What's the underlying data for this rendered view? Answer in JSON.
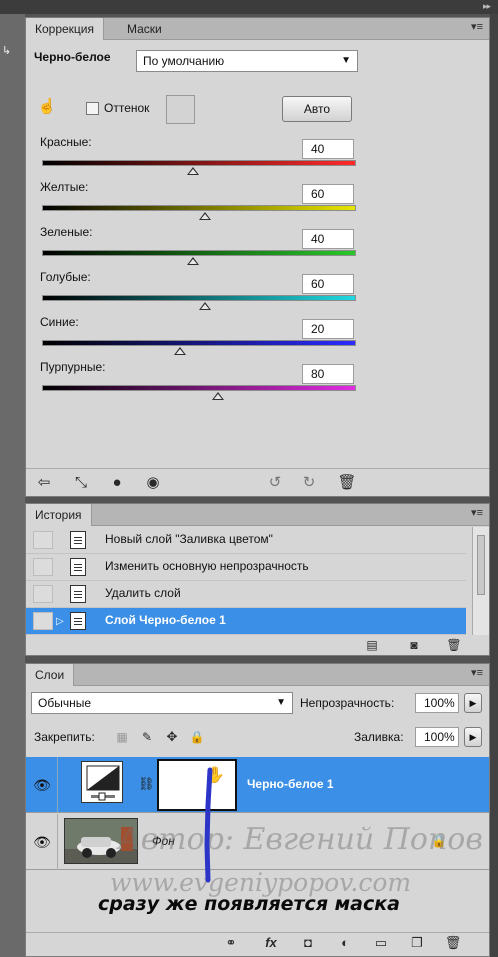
{
  "adjustments": {
    "tabs": [
      {
        "label": "Коррекция"
      },
      {
        "label": "Маски"
      }
    ],
    "title": "Черно-белое",
    "preset": "По умолчанию",
    "tint_label": "Оттенок",
    "auto_label": "Авто",
    "sliders": [
      {
        "label": "Красные:",
        "value": "40",
        "gradient": [
          "#000000",
          "#ff2a2a"
        ],
        "pos": 0.48
      },
      {
        "label": "Желтые:",
        "value": "60",
        "gradient": [
          "#000000",
          "#e8e600"
        ],
        "pos": 0.52
      },
      {
        "label": "Зеленые:",
        "value": "40",
        "gradient": [
          "#000000",
          "#28c828"
        ],
        "pos": 0.48
      },
      {
        "label": "Голубые:",
        "value": "60",
        "gradient": [
          "#000000",
          "#20d8e0"
        ],
        "pos": 0.52
      },
      {
        "label": "Синие:",
        "value": "20",
        "gradient": [
          "#000000",
          "#2b2bff"
        ],
        "pos": 0.44
      },
      {
        "label": "Пурпурные:",
        "value": "80",
        "gradient": [
          "#000000",
          "#e22ce2"
        ],
        "pos": 0.56
      }
    ]
  },
  "history": {
    "tab": "История",
    "items": [
      {
        "label": "Новый слой \"Заливка цветом\"",
        "selected": false
      },
      {
        "label": "Изменить основную непрозрачность",
        "selected": false
      },
      {
        "label": "Удалить слой",
        "selected": false
      },
      {
        "label": "Слой Черно-белое 1",
        "selected": true
      }
    ]
  },
  "layers": {
    "tab": "Слои",
    "blend_mode": "Обычные",
    "opacity_label": "Непрозрачность:",
    "opacity_value": "100%",
    "lock_label": "Закрепить:",
    "fill_label": "Заливка:",
    "fill_value": "100%",
    "items": [
      {
        "name": "Черно-белое 1",
        "selected": true
      },
      {
        "name": "Фон",
        "selected": false
      }
    ]
  },
  "watermark": {
    "author": "Автор: Евгений Попов",
    "site": "www.evgeniypopov.com"
  },
  "caption": "сразу же появляется маска",
  "colors": {
    "selection": "#3b8fe6",
    "panel": "#d6d6d6",
    "annotation_stroke": "#2c35c8"
  }
}
